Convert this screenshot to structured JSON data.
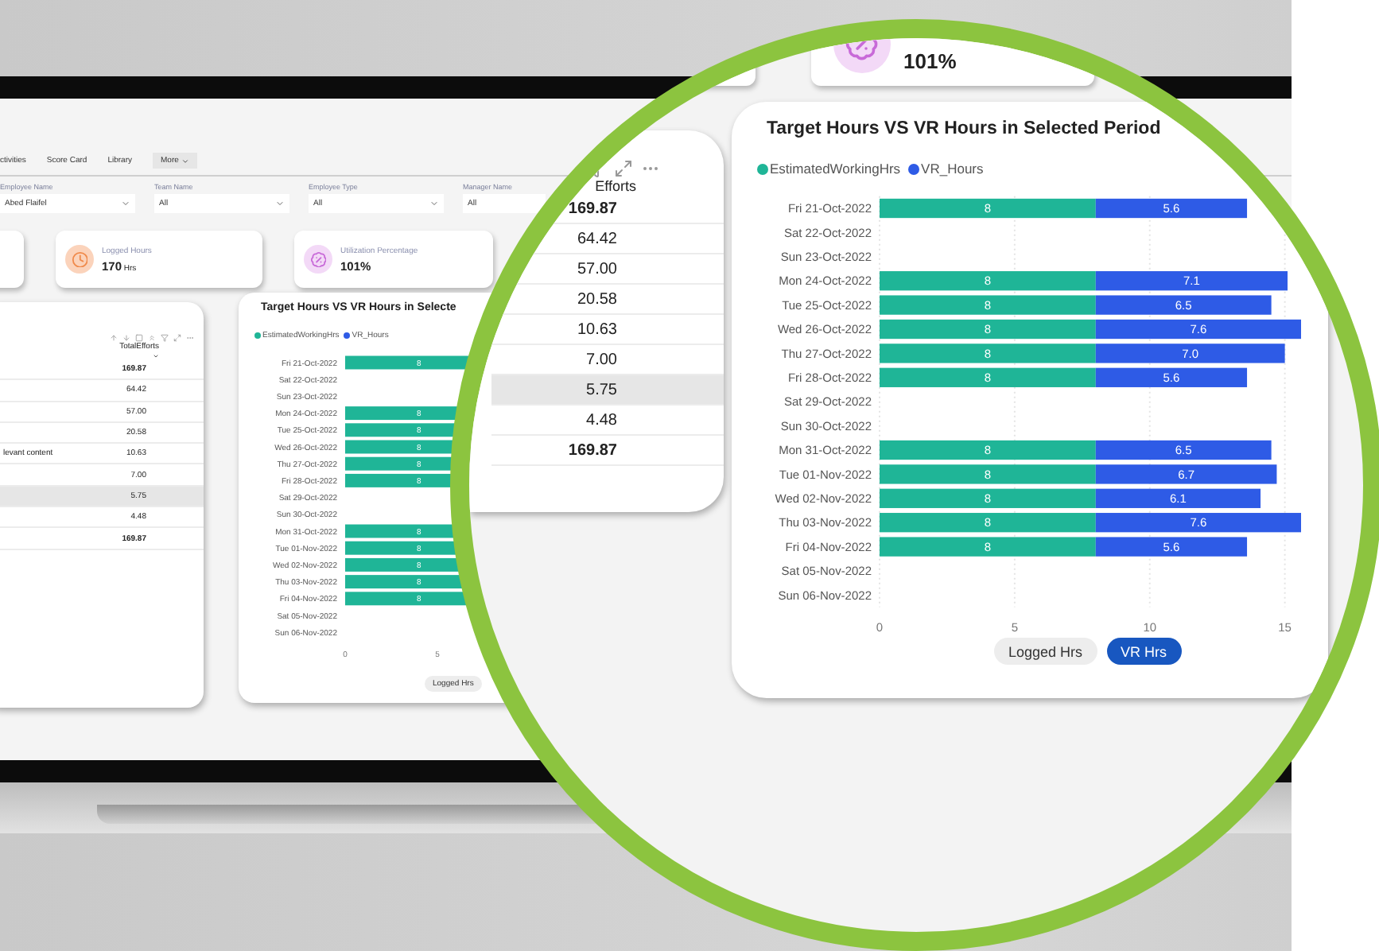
{
  "nav": {
    "tabs": [
      "ctivities",
      "Score Card",
      "Library"
    ],
    "more": "More"
  },
  "filters": [
    {
      "label": "Employee Name",
      "value": "Abed Flaifel"
    },
    {
      "label": "Team Name",
      "value": "All"
    },
    {
      "label": "Employee Type",
      "value": "All"
    },
    {
      "label": "Manager Name",
      "value": "All"
    }
  ],
  "kpis": [
    {
      "kind": "clock",
      "label": "Logged Hours",
      "value": "170",
      "unit": "Hrs"
    },
    {
      "kind": "percent",
      "label": "Utilization Percentage",
      "value": "101%"
    }
  ],
  "table": {
    "header": "TotalEfforts",
    "rows": [
      {
        "value": "169.87",
        "bold": true,
        "highlighted": false
      },
      {
        "value": "64.42",
        "bold": false,
        "highlighted": false
      },
      {
        "value": "57.00",
        "bold": false,
        "highlighted": false
      },
      {
        "value": "20.58",
        "bold": false,
        "highlighted": false
      },
      {
        "text": "levant content",
        "value": "10.63",
        "bold": false,
        "highlighted": false
      },
      {
        "value": "7.00",
        "bold": false,
        "highlighted": false
      },
      {
        "value": "5.75",
        "bold": false,
        "highlighted": true
      },
      {
        "value": "4.48",
        "bold": false,
        "highlighted": false
      },
      {
        "value": "169.87",
        "bold": true,
        "highlighted": false
      }
    ]
  },
  "chart": {
    "title": "Target Hours VS VR  Hours in Selecte",
    "legend": [
      {
        "name": "EstimatedWorkingHrs",
        "color": "#1fb597"
      },
      {
        "name": "VR_Hours",
        "color": "#2e5be6"
      }
    ],
    "rows": [
      {
        "label": "Fri 21-Oct-2022",
        "bar_label": "8"
      },
      {
        "label": "Sat 22-Oct-2022"
      },
      {
        "label": "Sun 23-Oct-2022"
      },
      {
        "label": "Mon 24-Oct-2022",
        "bar_label": "8"
      },
      {
        "label": "Tue 25-Oct-2022",
        "bar_label": "8"
      },
      {
        "label": "Wed 26-Oct-2022",
        "bar_label": "8"
      },
      {
        "label": "Thu 27-Oct-2022",
        "bar_label": "8"
      },
      {
        "label": "Fri 28-Oct-2022",
        "bar_label": "8"
      },
      {
        "label": "Sat 29-Oct-2022"
      },
      {
        "label": "Sun 30-Oct-2022"
      },
      {
        "label": "Mon 31-Oct-2022",
        "bar_label": "8"
      },
      {
        "label": "Tue 01-Nov-2022",
        "bar_label": "8"
      },
      {
        "label": "Wed 02-Nov-2022",
        "bar_label": "8"
      },
      {
        "label": "Thu 03-Nov-2022",
        "bar_label": "8"
      },
      {
        "label": "Fri 04-Nov-2022",
        "bar_label": "8"
      },
      {
        "label": "Sat 05-Nov-2022"
      },
      {
        "label": "Sun 06-Nov-2022"
      }
    ],
    "axis_ticks": [
      "0",
      "5"
    ],
    "toggles": [
      {
        "label": "Logged Hrs",
        "selected": false
      }
    ]
  },
  "magnifier": {
    "kpi": {
      "kind": "percent",
      "value": "101%"
    },
    "table": {
      "header": "Efforts",
      "rows": [
        {
          "value": "169.87",
          "bold": true,
          "highlighted": false
        },
        {
          "value": "64.42",
          "bold": false,
          "highlighted": false
        },
        {
          "value": "57.00",
          "bold": false,
          "highlighted": false
        },
        {
          "value": "20.58",
          "bold": false,
          "highlighted": false
        },
        {
          "value": "10.63",
          "bold": false,
          "highlighted": false
        },
        {
          "value": "7.00",
          "bold": false,
          "highlighted": false
        },
        {
          "value": "5.75",
          "bold": false,
          "highlighted": true
        },
        {
          "value": "4.48",
          "bold": false,
          "highlighted": false
        },
        {
          "value": "169.87",
          "bold": true,
          "highlighted": false
        }
      ]
    },
    "chart": {
      "title": "Target Hours VS VR  Hours in Selected Period",
      "chart_data": {
        "type": "bar",
        "orientation": "horizontal",
        "stacked": true,
        "data_labels": true,
        "grid": true,
        "xlim": [
          0,
          15.6
        ],
        "categories": [
          "Fri 21-Oct-2022",
          "Sat 22-Oct-2022",
          "Sun 23-Oct-2022",
          "Mon 24-Oct-2022",
          "Tue 25-Oct-2022",
          "Wed 26-Oct-2022",
          "Thu 27-Oct-2022",
          "Fri 28-Oct-2022",
          "Sat 29-Oct-2022",
          "Sun 30-Oct-2022",
          "Mon 31-Oct-2022",
          "Tue 01-Nov-2022",
          "Wed 02-Nov-2022",
          "Thu 03-Nov-2022",
          "Fri 04-Nov-2022",
          "Sat 05-Nov-2022",
          "Sun 06-Nov-2022"
        ],
        "series": [
          {
            "name": "EstimatedWorkingHrs",
            "color": "#1fb597",
            "values": [
              8,
              null,
              null,
              8,
              8,
              8,
              8,
              8,
              null,
              null,
              8,
              8,
              8,
              8,
              8,
              null,
              null
            ],
            "value_labels": [
              "8",
              null,
              null,
              "8",
              "8",
              "8",
              "8",
              "8",
              null,
              null,
              "8",
              "8",
              "8",
              "8",
              "8",
              null,
              null
            ]
          },
          {
            "name": "VR_Hours",
            "color": "#2e5be6",
            "values": [
              5.6,
              null,
              null,
              7.1,
              6.5,
              7.6,
              7.0,
              5.6,
              null,
              null,
              6.5,
              6.7,
              6.1,
              7.6,
              5.6,
              null,
              null
            ],
            "value_labels": [
              "5.6",
              null,
              null,
              "7.1",
              "6.5",
              "7.6",
              "7.0",
              "5.6",
              null,
              null,
              "6.5",
              "6.7",
              "6.1",
              "7.6",
              "5.6",
              null,
              null
            ]
          }
        ],
        "xticks": [
          0,
          5,
          10,
          15
        ]
      },
      "toggles": [
        {
          "label": "Logged Hrs",
          "selected": false
        },
        {
          "label": "VR Hrs",
          "selected": true
        }
      ]
    }
  }
}
